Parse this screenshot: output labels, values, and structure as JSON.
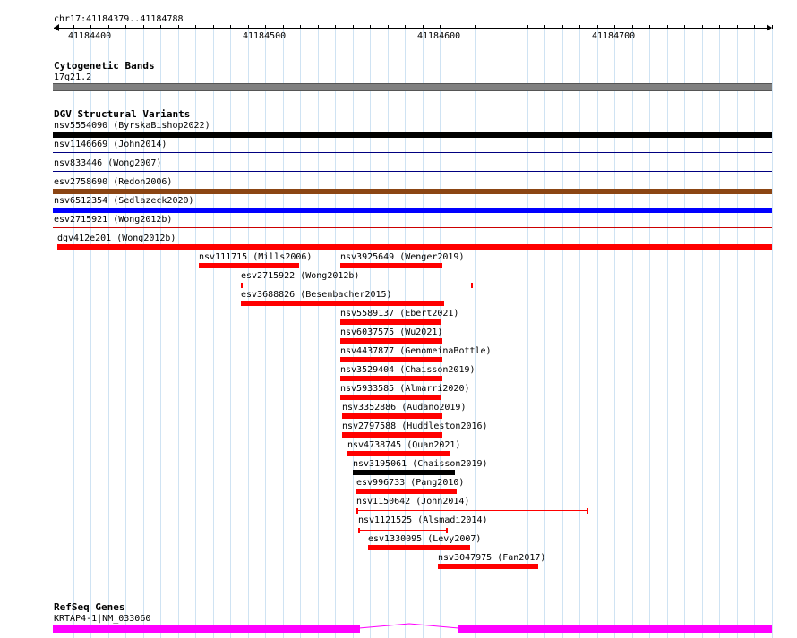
{
  "region": {
    "label": "chr17:41184379..41184788",
    "ticks": [
      "41184400",
      "41184500",
      "41184600",
      "41184700"
    ]
  },
  "cytobands": {
    "title": "Cytogenetic Bands",
    "band": "17q21.2"
  },
  "dgv": {
    "title": "DGV Structural Variants",
    "items": [
      {
        "label": "nsv5554090 (ByrskaBishop2022)",
        "color": "#000000",
        "style": "thick"
      },
      {
        "label": "nsv1146669 (John2014)",
        "color": "#000080",
        "style": "thin"
      },
      {
        "label": "nsv833446 (Wong2007)",
        "color": "#000080",
        "style": "thin"
      },
      {
        "label": "esv2758690 (Redon2006)",
        "color": "#8b4513",
        "style": "thick"
      },
      {
        "label": "nsv6512354 (Sedlazeck2020)",
        "color": "#0000ff",
        "style": "thick"
      },
      {
        "label": "esv2715921 (Wong2012b)",
        "color": "#cc0000",
        "style": "thin"
      },
      {
        "label": "dgv412e201 (Wong2012b)",
        "color": "#ff0000",
        "style": "thick"
      },
      {
        "label": "nsv111715 (Mills2006)",
        "color": "#ff0000",
        "style": "thick"
      },
      {
        "label": "nsv3925649 (Wenger2019)",
        "color": "#ff0000",
        "style": "thick"
      },
      {
        "label": "esv2715922 (Wong2012b)",
        "color": "#ff0000",
        "style": "bracket"
      },
      {
        "label": "esv3688826 (Besenbacher2015)",
        "color": "#ff0000",
        "style": "thick"
      },
      {
        "label": "nsv5589137 (Ebert2021)",
        "color": "#ff0000",
        "style": "thick"
      },
      {
        "label": "nsv6037575 (Wu2021)",
        "color": "#ff0000",
        "style": "thick"
      },
      {
        "label": "nsv4437877 (GenomeinaBottle)",
        "color": "#ff0000",
        "style": "thick"
      },
      {
        "label": "nsv3529404 (Chaisson2019)",
        "color": "#ff0000",
        "style": "thick"
      },
      {
        "label": "nsv5933585 (Almarri2020)",
        "color": "#ff0000",
        "style": "thick"
      },
      {
        "label": "nsv3352886 (Audano2019)",
        "color": "#ff0000",
        "style": "thick"
      },
      {
        "label": "nsv2797588 (Huddleston2016)",
        "color": "#ff0000",
        "style": "thick"
      },
      {
        "label": "nsv4738745 (Quan2021)",
        "color": "#ff0000",
        "style": "thick"
      },
      {
        "label": "nsv3195061 (Chaisson2019)",
        "color": "#000000",
        "style": "thick"
      },
      {
        "label": "esv996733 (Pang2010)",
        "color": "#ff0000",
        "style": "thick"
      },
      {
        "label": "nsv1150642 (John2014)",
        "color": "#ff0000",
        "style": "bracket"
      },
      {
        "label": "nsv1121525 (Alsmadi2014)",
        "color": "#ff0000",
        "style": "bracket"
      },
      {
        "label": "esv1330095 (Levy2007)",
        "color": "#ff0000",
        "style": "thick"
      },
      {
        "label": "nsv3047975 (Fan2017)",
        "color": "#ff0000",
        "style": "thick"
      }
    ]
  },
  "refseq": {
    "title": "RefSeq Genes",
    "gene": "KRTAP4-1|NM_033060",
    "color": "#ff00ff"
  },
  "colors": {
    "grid": "#cfe3f3",
    "cytoband": "#808080",
    "ruler": "#000000"
  }
}
